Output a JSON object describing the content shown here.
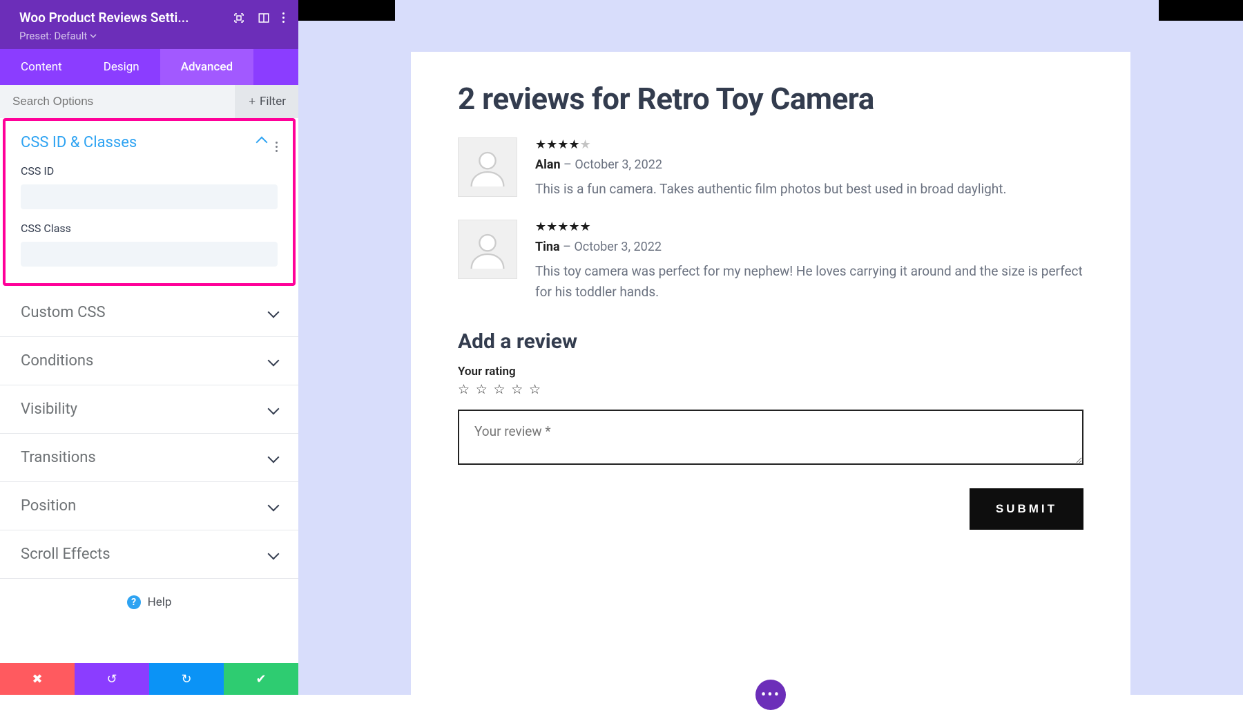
{
  "titlebar": {
    "title": "Woo Product Reviews Setti...",
    "preset_label": "Preset: Default"
  },
  "tabs": {
    "content": "Content",
    "design": "Design",
    "advanced": "Advanced"
  },
  "search": {
    "placeholder": "Search Options",
    "filter": "Filter"
  },
  "panel_open": {
    "title": "CSS ID & Classes",
    "css_id_label": "CSS ID",
    "css_id_value": "",
    "css_class_label": "CSS Class",
    "css_class_value": ""
  },
  "panels_closed": [
    "Custom CSS",
    "Conditions",
    "Visibility",
    "Transitions",
    "Position",
    "Scroll Effects"
  ],
  "help_label": "Help",
  "preview": {
    "heading": "2 reviews for Retro Toy Camera",
    "reviews": [
      {
        "author": "Alan",
        "date": "October 3, 2022",
        "sep": " – ",
        "stars": 4,
        "text": "This is a fun camera. Takes authentic film photos but best used in broad daylight."
      },
      {
        "author": "Tina",
        "date": "October 3, 2022",
        "sep": " – ",
        "stars": 5,
        "text": "This toy camera was perfect for my nephew! He loves carrying it around and the size is perfect for his toddler hands."
      }
    ],
    "add_heading": "Add a review",
    "rating_label": "Your rating",
    "textarea_placeholder": "Your review *",
    "submit": "SUBMIT"
  }
}
